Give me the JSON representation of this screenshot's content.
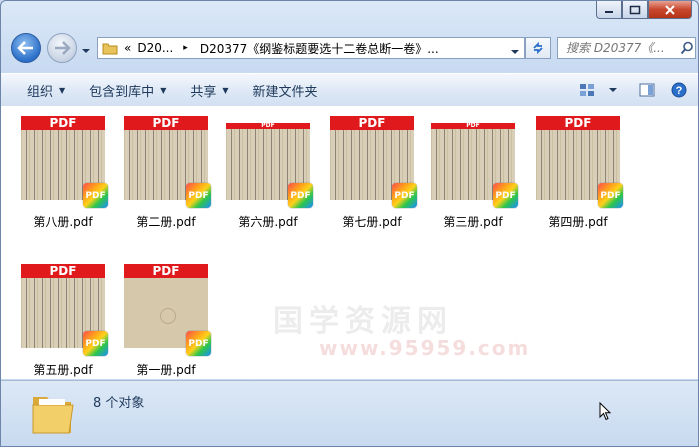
{
  "window": {
    "caption_buttons": [
      "minimize",
      "maximize",
      "close"
    ]
  },
  "address": {
    "crumb_prefix": "«",
    "crumb_1": "D20...",
    "separator": "▸",
    "crumb_2": "D20377《纲鉴标题要选十二卷总断一卷》...",
    "search_placeholder": "搜索 D20377《..."
  },
  "toolbar": {
    "organize": "组织",
    "include_in_library": "包含到库中",
    "share": "共享",
    "new_folder": "新建文件夹"
  },
  "files": [
    {
      "name": "第八册.pdf",
      "band": "PDF",
      "badge": "PDF",
      "blank": false
    },
    {
      "name": "第二册.pdf",
      "band": "PDF",
      "badge": "PDF",
      "blank": false
    },
    {
      "name": "第六册.pdf",
      "band": "PDF",
      "badge": "PDF",
      "blank": false
    },
    {
      "name": "第七册.pdf",
      "band": "PDF",
      "badge": "PDF",
      "blank": false
    },
    {
      "name": "第三册.pdf",
      "band": "PDF",
      "badge": "PDF",
      "blank": false
    },
    {
      "name": "第四册.pdf",
      "band": "PDF",
      "badge": "PDF",
      "blank": false
    },
    {
      "name": "第五册.pdf",
      "band": "PDF",
      "badge": "PDF",
      "blank": false
    },
    {
      "name": "第一册.pdf",
      "band": "PDF",
      "badge": "PDF",
      "blank": true
    }
  ],
  "status": {
    "count_text": "8 个对象"
  },
  "watermark": {
    "line1": "国学资源网",
    "line2": "www.95959.com"
  },
  "colors": {
    "pdf_band": "#e0191d",
    "toolbar_text": "#1e395b",
    "close_button": "#c9462d"
  }
}
